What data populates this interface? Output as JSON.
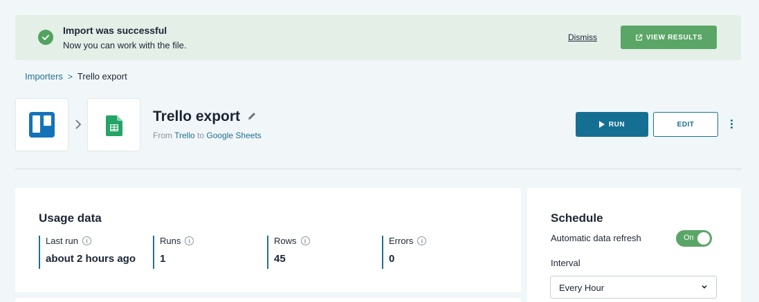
{
  "banner": {
    "title": "Import was successful",
    "subtitle": "Now you can work with the file.",
    "dismiss_label": "Dismiss",
    "view_results_label": "VIEW RESULTS"
  },
  "breadcrumb": {
    "parent": "Importers",
    "separator": ">",
    "current": "Trello export"
  },
  "importer": {
    "title": "Trello export",
    "from_prefix": "From",
    "source": "Trello",
    "to_word": "to",
    "destination": "Google Sheets",
    "source_icon": "trello-logo-icon",
    "destination_icon": "google-sheets-icon"
  },
  "actions": {
    "run_label": "RUN",
    "edit_label": "EDIT"
  },
  "usage": {
    "heading": "Usage data",
    "stats": [
      {
        "label": "Last run",
        "value": "about 2 hours ago"
      },
      {
        "label": "Runs",
        "value": "1"
      },
      {
        "label": "Rows",
        "value": "45"
      },
      {
        "label": "Errors",
        "value": "0"
      }
    ],
    "info_glyph": "i"
  },
  "schedule": {
    "heading": "Schedule",
    "auto_refresh_label": "Automatic data refresh",
    "toggle_state": "On",
    "interval_label": "Interval",
    "interval_value": "Every Hour"
  },
  "colors": {
    "accent": "#156f93",
    "success": "#5aa667",
    "banner_bg": "#e3efe7",
    "page_bg": "#f1f6f8"
  }
}
